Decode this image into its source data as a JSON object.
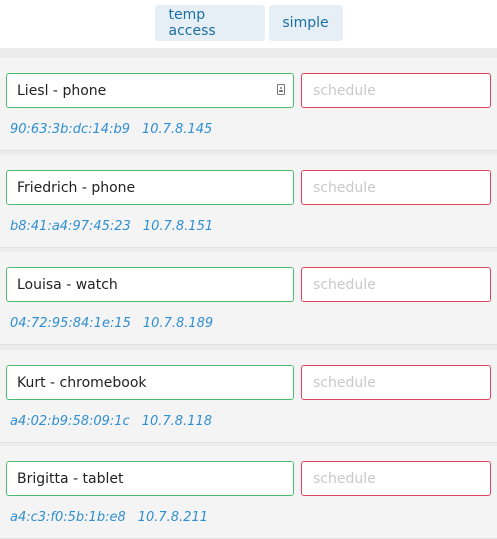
{
  "tabs": {
    "temp_access": "temp access",
    "simple": "simple"
  },
  "placeholder": "schedule",
  "devices": [
    {
      "name": "Liesl - phone",
      "mac": "90:63:3b:dc:14:b9",
      "ip": "10.7.8.145",
      "has_contact_icon": true
    },
    {
      "name": "Friedrich - phone",
      "mac": "b8:41:a4:97:45:23",
      "ip": "10.7.8.151"
    },
    {
      "name": "Louisa - watch",
      "mac": "04:72:95:84:1e:15",
      "ip": "10.7.8.189"
    },
    {
      "name": "Kurt - chromebook",
      "mac": "a4:02:b9:58:09:1c",
      "ip": "10.7.8.118"
    },
    {
      "name": "Brigitta - tablet",
      "mac": "a4:c3:f0:5b:1b:e8",
      "ip": "10.7.8.211"
    }
  ],
  "colors": {
    "name_border": "#4cbb6f",
    "schedule_border": "#e0465e",
    "meta_text": "#2f8fd0",
    "tab_bg": "#e6eff5",
    "tab_text": "#1c6fa0"
  }
}
